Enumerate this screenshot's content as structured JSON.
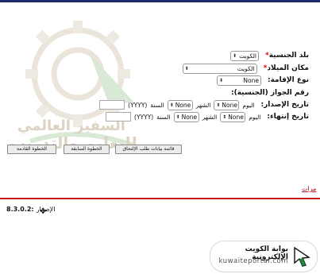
{
  "form": {
    "nationality": {
      "label": "بلد الجنسية",
      "required_mark": "*",
      "value": "الكويت"
    },
    "birthplace": {
      "label": "مكان الميلاد",
      "required_mark": "*",
      "value": "الكويت"
    },
    "residence_type": {
      "label": "نوع الإقامة:",
      "value": "None"
    },
    "passport_number": {
      "label": "رقم الجواز (الجنسية):"
    },
    "issue_date": {
      "label": "تاريخ الإصدار:",
      "day_label": "اليوم",
      "day_value": "None",
      "month_label": "الشهر",
      "month_value": "None",
      "year_label": "السنة",
      "year_hint": "(YYYY)"
    },
    "expiry_date": {
      "label": "تاريخ إنتهاء:",
      "day_label": "اليوم",
      "day_value": "None",
      "month_label": "الشهر",
      "month_value": "None",
      "year_label": "السنة",
      "year_hint": "(YYYY)"
    }
  },
  "buttons": {
    "list": "قائمة بيانات طلب الإلتحاق",
    "previous": "الخطوة السابقة",
    "next": "الخطوة القادمة"
  },
  "link_partial": "مرات",
  "version": {
    "number": "8.3.0.2:",
    "label": "الإصدار"
  },
  "watermark": {
    "line1": "السفير العالمي",
    "line2": "للتعليم والتدريب"
  },
  "portal": {
    "arabic": "بوابة الكويت الإلكترونية",
    "english": "kuwaiteportal.com"
  },
  "colors": {
    "accent_red": "#c31818",
    "top_bar": "#1a2a6c",
    "watermark": "#dcd3c2",
    "portal_green": "#1f8a3a"
  },
  "icons": {
    "select_arrow": "updown-arrow-icon",
    "cursor": "mouse-cursor-icon",
    "portal_logo": "arrow-logo-icon"
  }
}
